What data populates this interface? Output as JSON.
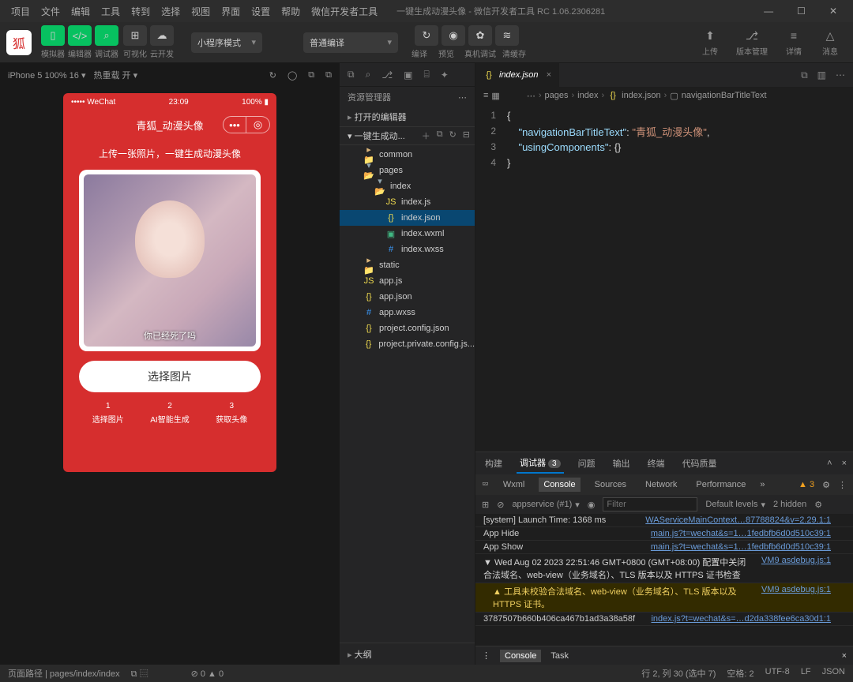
{
  "menu": {
    "items": [
      "项目",
      "文件",
      "编辑",
      "工具",
      "转到",
      "选择",
      "视图",
      "界面",
      "设置",
      "帮助",
      "微信开发者工具"
    ],
    "title": "一键生成动漫头像 - 微信开发者工具 RC 1.06.2306281"
  },
  "win": {
    "min": "—",
    "max": "☐",
    "close": "✕"
  },
  "toolbar": {
    "groupA": {
      "labels": [
        "模拟器",
        "编辑器",
        "调试器"
      ]
    },
    "groupB": {
      "labels": [
        "可视化",
        "云开发"
      ]
    },
    "mode": "小程序模式",
    "compile": "普通编译",
    "center": {
      "labels": [
        "编译",
        "预览",
        "真机调试",
        "清缓存"
      ]
    },
    "right": {
      "labels": [
        "上传",
        "版本管理",
        "详情",
        "消息"
      ]
    }
  },
  "sim": {
    "device": "iPhone 5 100% 16",
    "hot": "热重载 开"
  },
  "phone": {
    "carrier": "••••• WeChat",
    "time": "23:09",
    "battery": "100%",
    "title": "青狐_动漫头像",
    "desc": "上传一张照片，一键生成动漫头像",
    "btn": "选择图片",
    "steps": [
      [
        "1",
        "选择图片"
      ],
      [
        "2",
        "AI智能生成"
      ],
      [
        "3",
        "获取头像"
      ]
    ]
  },
  "explorer": {
    "head": "资源管理器",
    "section1": "打开的编辑器",
    "root": "一键生成动...",
    "tree": [
      {
        "t": "folder",
        "n": "common",
        "l": 1
      },
      {
        "t": "folder-open",
        "n": "pages",
        "l": 1,
        "open": true
      },
      {
        "t": "folder-open",
        "n": "index",
        "l": 2,
        "open": true
      },
      {
        "t": "js",
        "n": "index.js",
        "l": 3
      },
      {
        "t": "json",
        "n": "index.json",
        "l": 3,
        "sel": true
      },
      {
        "t": "wxml",
        "n": "index.wxml",
        "l": 3
      },
      {
        "t": "wxss",
        "n": "index.wxss",
        "l": 3
      },
      {
        "t": "folder",
        "n": "static",
        "l": 1
      },
      {
        "t": "js",
        "n": "app.js",
        "l": 1
      },
      {
        "t": "json",
        "n": "app.json",
        "l": 1
      },
      {
        "t": "wxss",
        "n": "app.wxss",
        "l": 1
      },
      {
        "t": "json",
        "n": "project.config.json",
        "l": 1
      },
      {
        "t": "json",
        "n": "project.private.config.js...",
        "l": 1
      }
    ],
    "outline": "大纲"
  },
  "editor": {
    "tab": "index.json",
    "breadcrumb": [
      "pages",
      "index",
      "index.json",
      "navigationBarTitleText"
    ],
    "lines": [
      {
        "n": "1",
        "raw": "{"
      },
      {
        "n": "2",
        "raw": "    \"navigationBarTitleText\": \"青狐_动漫头像\","
      },
      {
        "n": "3",
        "raw": "    \"usingComponents\": {}"
      },
      {
        "n": "4",
        "raw": "}"
      }
    ]
  },
  "devtools": {
    "tabs": [
      "构建",
      "调试器",
      "问题",
      "输出",
      "终端",
      "代码质量"
    ],
    "badge": "3",
    "sub": [
      "Wxml",
      "Console",
      "Sources",
      "Network",
      "Performance"
    ],
    "warn": "3",
    "filter": {
      "ctx": "appservice (#1)",
      "ph": "Filter",
      "lvl": "Default levels",
      "hidden": "2 hidden"
    },
    "lines": [
      {
        "t": "[system] Launch Time: 1368 ms",
        "s": "WAServiceMainContext…87788824&v=2.29.1:1"
      },
      {
        "t": "App Hide",
        "s": "main.js?t=wechat&s=1…1fedbfb6d0d510c39:1"
      },
      {
        "t": "App Show",
        "s": "main.js?t=wechat&s=1…1fedbfb6d0d510c39:1"
      },
      {
        "g": true,
        "t": "▼ Wed Aug 02 2023 22:51:46 GMT+0800 (GMT+08:00) 配置中关闭 合法域名、web-view（业务域名）、TLS 版本以及 HTTPS 证书检查",
        "s": "VM9 asdebug.js:1"
      },
      {
        "w": true,
        "t": "▲ 工具未校验合法域名、web-view（业务域名）、TLS 版本以及 HTTPS 证书。",
        "s": "VM9 asdebug.js:1",
        "indent": true
      },
      {
        "t": "3787507b660b406ca467b1ad3a38a58f",
        "s": "index.js?t=wechat&s=…d2da338fee6ca30d1:1"
      }
    ],
    "drawer": [
      "Console",
      "Task"
    ]
  },
  "status": {
    "path": "页面路径 | pages/index/index",
    "right": [
      "行 2, 列 30 (选中 7)",
      "空格: 2",
      "UTF-8",
      "LF",
      "JSON"
    ]
  }
}
